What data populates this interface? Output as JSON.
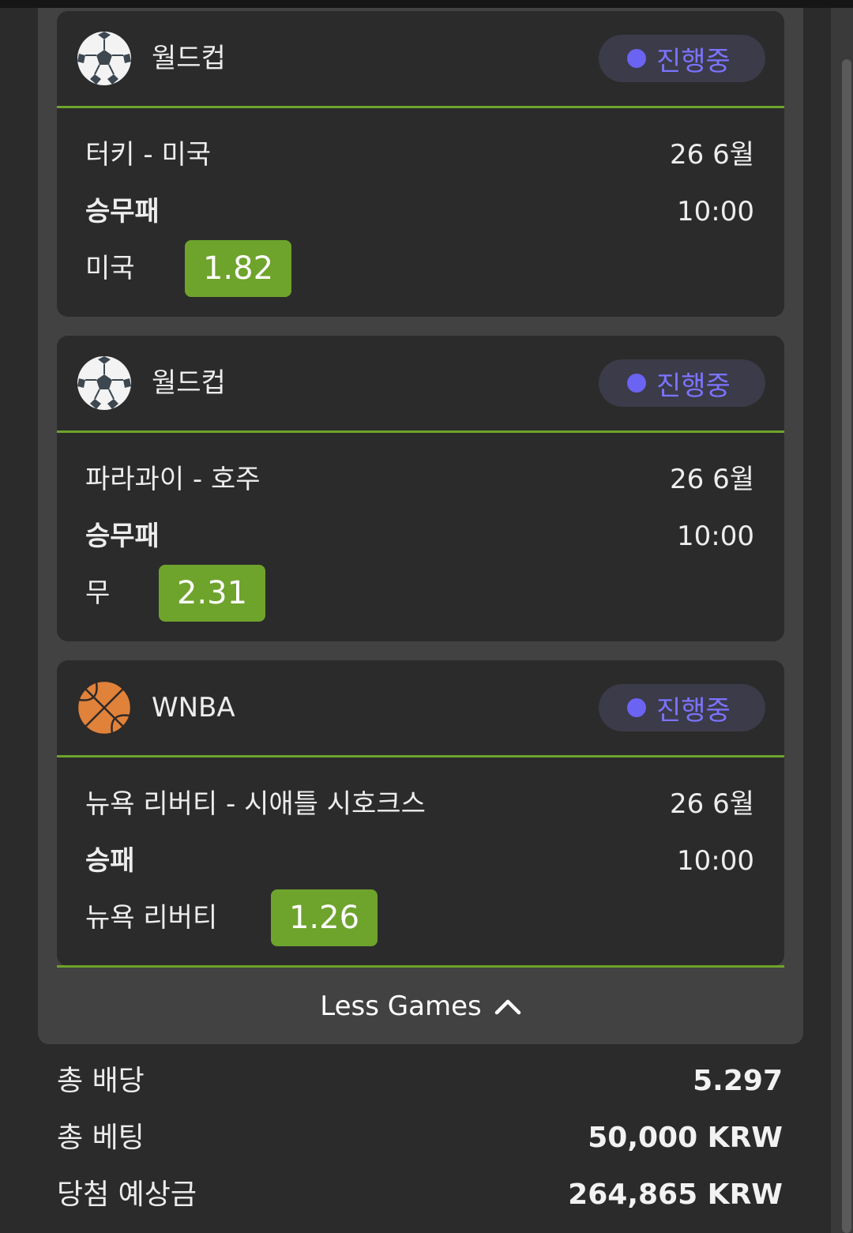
{
  "colors": {
    "accent_green": "#6ea32c",
    "status_purple": "#7c73ff",
    "card_bg": "#2b2b2b",
    "panel_bg": "#424242"
  },
  "bets": [
    {
      "sport_icon": "soccer-ball-icon",
      "league": "월드컵",
      "status": "진행중",
      "match": "터키 - 미국",
      "date": "26 6월",
      "market": "승무패",
      "time": "10:00",
      "pick": "미국",
      "odds": "1.82"
    },
    {
      "sport_icon": "soccer-ball-icon",
      "league": "월드컵",
      "status": "진행중",
      "match": "파라과이 - 호주",
      "date": "26 6월",
      "market": "승무패",
      "time": "10:00",
      "pick": "무",
      "odds": "2.31"
    },
    {
      "sport_icon": "basketball-icon",
      "league": "WNBA",
      "status": "진행중",
      "match": "뉴욕 리버티 - 시애틀 시호크스",
      "date": "26 6월",
      "market": "승패",
      "time": "10:00",
      "pick": "뉴욕 리버티",
      "odds": "1.26"
    }
  ],
  "toggle": {
    "label": "Less Games"
  },
  "summary": {
    "total_odds_label": "총 배당",
    "total_odds_value": "5.297",
    "total_bet_label": "총 베팅",
    "total_bet_value": "50,000 KRW",
    "expected_win_label": "당첨 예상금",
    "expected_win_value": "264,865 KRW"
  }
}
